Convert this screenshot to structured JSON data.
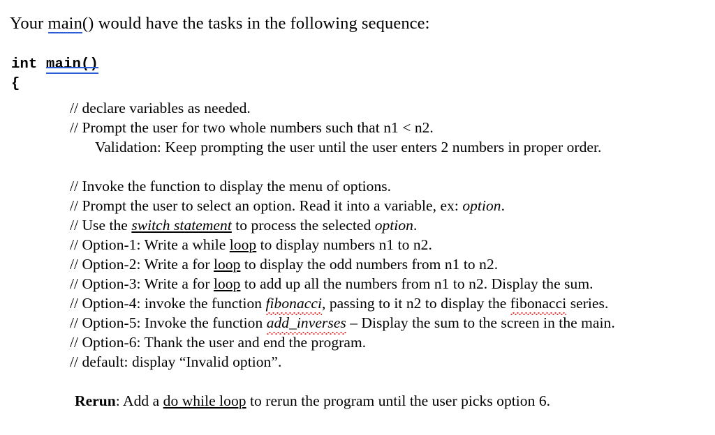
{
  "document": {
    "intro": {
      "before": "Your ",
      "link": "main",
      "after_link": "()",
      "after": " would have the tasks in the following sequence:"
    },
    "code": {
      "keyword": "int ",
      "function_name": "main",
      "parens": "()",
      "open_brace": "{"
    },
    "lines": [
      {
        "id": "declare-variables",
        "text": "// declare variables as needed."
      },
      {
        "id": "prompt-two-numbers",
        "text": "// Prompt the user for two whole numbers such that n1 < n2."
      },
      {
        "id": "validation",
        "text": "Validation: Keep prompting the user until the user enters 2 numbers in proper order."
      },
      {
        "id": "invoke-menu",
        "text": "// Invoke the function to display the menu of options."
      },
      {
        "id": "prompt-option",
        "prefix": "// Prompt the user to select an option. Read it into a variable, ex: ",
        "emphasis": "option",
        "suffix": "."
      },
      {
        "id": "use-switch",
        "prefix": "// Use the ",
        "emphasis": "switch statement",
        "middle": " to process the selected ",
        "emphasis2": "option",
        "suffix": "."
      },
      {
        "id": "option-1",
        "prefix": "// Option-1:  Write a while ",
        "emphasis": "loop",
        "suffix": " to display numbers n1 to n2."
      },
      {
        "id": "option-2",
        "prefix": "// Option-2: Write a for ",
        "emphasis": "loop",
        "suffix": " to display the odd numbers from n1 to n2."
      },
      {
        "id": "option-3",
        "prefix": "// Option-3: Write a for ",
        "emphasis": "loop",
        "suffix": " to add up all the numbers from n1 to n2. Display the sum."
      },
      {
        "id": "option-4",
        "prefix": "// Option-4: invoke the function ",
        "emphasis": "fibonacci",
        "middle": ", passing to it n2 to display the ",
        "emphasis2": "fibonacci",
        "suffix": " series."
      },
      {
        "id": "option-5",
        "prefix": "// Option-5: Invoke the function ",
        "emphasis": "add_inverses",
        "suffix": " – Display the sum to the screen in the main."
      },
      {
        "id": "option-6",
        "text": "// Option-6: Thank the user and end the program."
      },
      {
        "id": "default-case",
        "text": "// default: display “Invalid option”."
      },
      {
        "id": "rerun",
        "label": "Rerun",
        "prefix": ": Add a ",
        "emphasis": "do while loop",
        "suffix": " to rerun the program until the user picks option 6."
      }
    ],
    "colors": {
      "hyperlink_underline": "#2b5fd9",
      "spellcheck_underline": "#e03131",
      "text": "#000000",
      "background": "#ffffff"
    }
  }
}
